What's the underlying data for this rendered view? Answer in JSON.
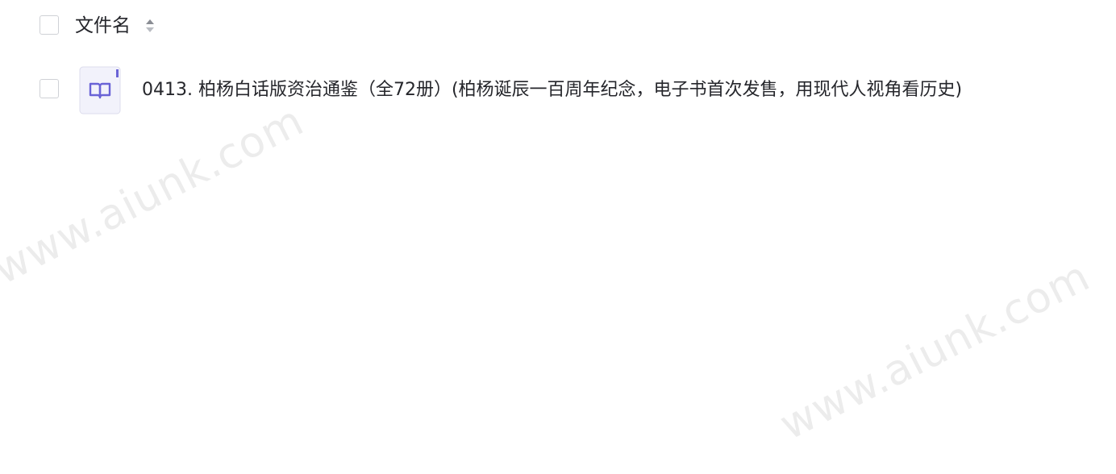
{
  "header": {
    "select_all_checked": false,
    "column_title": "文件名",
    "sort_icon": "sort-caret-icon"
  },
  "files": [
    {
      "checked": false,
      "icon": "book-icon",
      "icon_color": "#6a63d6",
      "name": "0413. 柏杨白话版资治通鉴（全72册）(柏杨诞辰一百周年纪念，电子书首次发售，用现代人视角看历史)"
    }
  ],
  "watermarks": [
    "www.aiunk.com",
    "www.aiunk.com"
  ]
}
